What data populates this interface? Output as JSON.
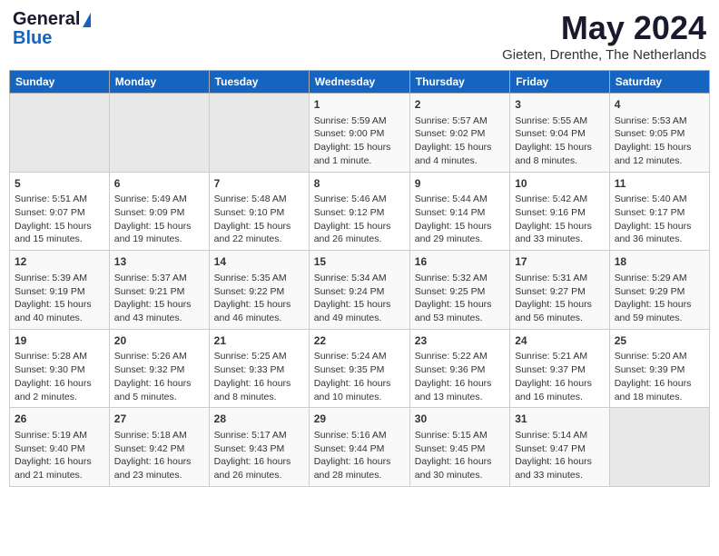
{
  "header": {
    "logo_general": "General",
    "logo_blue": "Blue",
    "title": "May 2024",
    "subtitle": "Gieten, Drenthe, The Netherlands"
  },
  "calendar": {
    "weekdays": [
      "Sunday",
      "Monday",
      "Tuesday",
      "Wednesday",
      "Thursday",
      "Friday",
      "Saturday"
    ],
    "weeks": [
      [
        {
          "day": "",
          "empty": true
        },
        {
          "day": "",
          "empty": true
        },
        {
          "day": "",
          "empty": true
        },
        {
          "day": "1",
          "sunrise": "5:59 AM",
          "sunset": "9:00 PM",
          "daylight": "15 hours and 1 minute."
        },
        {
          "day": "2",
          "sunrise": "5:57 AM",
          "sunset": "9:02 PM",
          "daylight": "15 hours and 4 minutes."
        },
        {
          "day": "3",
          "sunrise": "5:55 AM",
          "sunset": "9:04 PM",
          "daylight": "15 hours and 8 minutes."
        },
        {
          "day": "4",
          "sunrise": "5:53 AM",
          "sunset": "9:05 PM",
          "daylight": "15 hours and 12 minutes."
        }
      ],
      [
        {
          "day": "5",
          "sunrise": "5:51 AM",
          "sunset": "9:07 PM",
          "daylight": "15 hours and 15 minutes."
        },
        {
          "day": "6",
          "sunrise": "5:49 AM",
          "sunset": "9:09 PM",
          "daylight": "15 hours and 19 minutes."
        },
        {
          "day": "7",
          "sunrise": "5:48 AM",
          "sunset": "9:10 PM",
          "daylight": "15 hours and 22 minutes."
        },
        {
          "day": "8",
          "sunrise": "5:46 AM",
          "sunset": "9:12 PM",
          "daylight": "15 hours and 26 minutes."
        },
        {
          "day": "9",
          "sunrise": "5:44 AM",
          "sunset": "9:14 PM",
          "daylight": "15 hours and 29 minutes."
        },
        {
          "day": "10",
          "sunrise": "5:42 AM",
          "sunset": "9:16 PM",
          "daylight": "15 hours and 33 minutes."
        },
        {
          "day": "11",
          "sunrise": "5:40 AM",
          "sunset": "9:17 PM",
          "daylight": "15 hours and 36 minutes."
        }
      ],
      [
        {
          "day": "12",
          "sunrise": "5:39 AM",
          "sunset": "9:19 PM",
          "daylight": "15 hours and 40 minutes."
        },
        {
          "day": "13",
          "sunrise": "5:37 AM",
          "sunset": "9:21 PM",
          "daylight": "15 hours and 43 minutes."
        },
        {
          "day": "14",
          "sunrise": "5:35 AM",
          "sunset": "9:22 PM",
          "daylight": "15 hours and 46 minutes."
        },
        {
          "day": "15",
          "sunrise": "5:34 AM",
          "sunset": "9:24 PM",
          "daylight": "15 hours and 49 minutes."
        },
        {
          "day": "16",
          "sunrise": "5:32 AM",
          "sunset": "9:25 PM",
          "daylight": "15 hours and 53 minutes."
        },
        {
          "day": "17",
          "sunrise": "5:31 AM",
          "sunset": "9:27 PM",
          "daylight": "15 hours and 56 minutes."
        },
        {
          "day": "18",
          "sunrise": "5:29 AM",
          "sunset": "9:29 PM",
          "daylight": "15 hours and 59 minutes."
        }
      ],
      [
        {
          "day": "19",
          "sunrise": "5:28 AM",
          "sunset": "9:30 PM",
          "daylight": "16 hours and 2 minutes."
        },
        {
          "day": "20",
          "sunrise": "5:26 AM",
          "sunset": "9:32 PM",
          "daylight": "16 hours and 5 minutes."
        },
        {
          "day": "21",
          "sunrise": "5:25 AM",
          "sunset": "9:33 PM",
          "daylight": "16 hours and 8 minutes."
        },
        {
          "day": "22",
          "sunrise": "5:24 AM",
          "sunset": "9:35 PM",
          "daylight": "16 hours and 10 minutes."
        },
        {
          "day": "23",
          "sunrise": "5:22 AM",
          "sunset": "9:36 PM",
          "daylight": "16 hours and 13 minutes."
        },
        {
          "day": "24",
          "sunrise": "5:21 AM",
          "sunset": "9:37 PM",
          "daylight": "16 hours and 16 minutes."
        },
        {
          "day": "25",
          "sunrise": "5:20 AM",
          "sunset": "9:39 PM",
          "daylight": "16 hours and 18 minutes."
        }
      ],
      [
        {
          "day": "26",
          "sunrise": "5:19 AM",
          "sunset": "9:40 PM",
          "daylight": "16 hours and 21 minutes."
        },
        {
          "day": "27",
          "sunrise": "5:18 AM",
          "sunset": "9:42 PM",
          "daylight": "16 hours and 23 minutes."
        },
        {
          "day": "28",
          "sunrise": "5:17 AM",
          "sunset": "9:43 PM",
          "daylight": "16 hours and 26 minutes."
        },
        {
          "day": "29",
          "sunrise": "5:16 AM",
          "sunset": "9:44 PM",
          "daylight": "16 hours and 28 minutes."
        },
        {
          "day": "30",
          "sunrise": "5:15 AM",
          "sunset": "9:45 PM",
          "daylight": "16 hours and 30 minutes."
        },
        {
          "day": "31",
          "sunrise": "5:14 AM",
          "sunset": "9:47 PM",
          "daylight": "16 hours and 33 minutes."
        },
        {
          "day": "",
          "empty": true
        }
      ]
    ]
  }
}
